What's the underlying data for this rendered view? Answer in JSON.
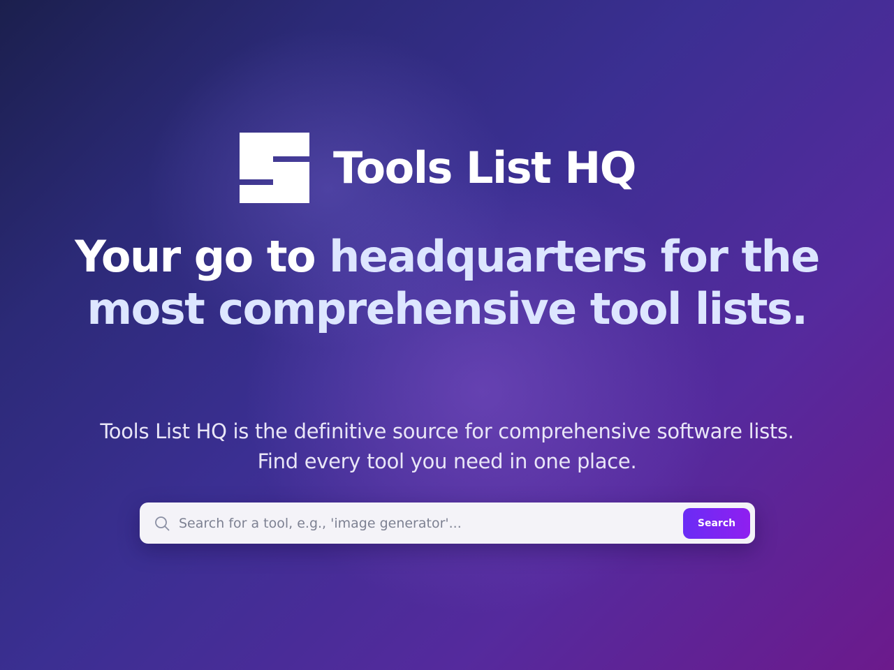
{
  "brand": {
    "name": "Tools List HQ",
    "logo_icon": "stepped-square-logo-icon"
  },
  "hero": {
    "headline_part_1": "Your go to ",
    "headline_part_2": "headquarters for the most comprehensive tool lists.",
    "subtitle": "Tools List HQ is the definitive source for comprehensive software lists. Find every tool you need in one place."
  },
  "search": {
    "icon": "search-icon",
    "placeholder": "Search for a tool, e.g., 'image generator'...",
    "value": "",
    "button_label": "Search"
  },
  "colors": {
    "background_start": "#1b1f4d",
    "background_end": "#6c1a8c",
    "headline_accent": "#dde6ff",
    "button_start": "#6a2cf5",
    "button_end": "#8f1ff0"
  }
}
